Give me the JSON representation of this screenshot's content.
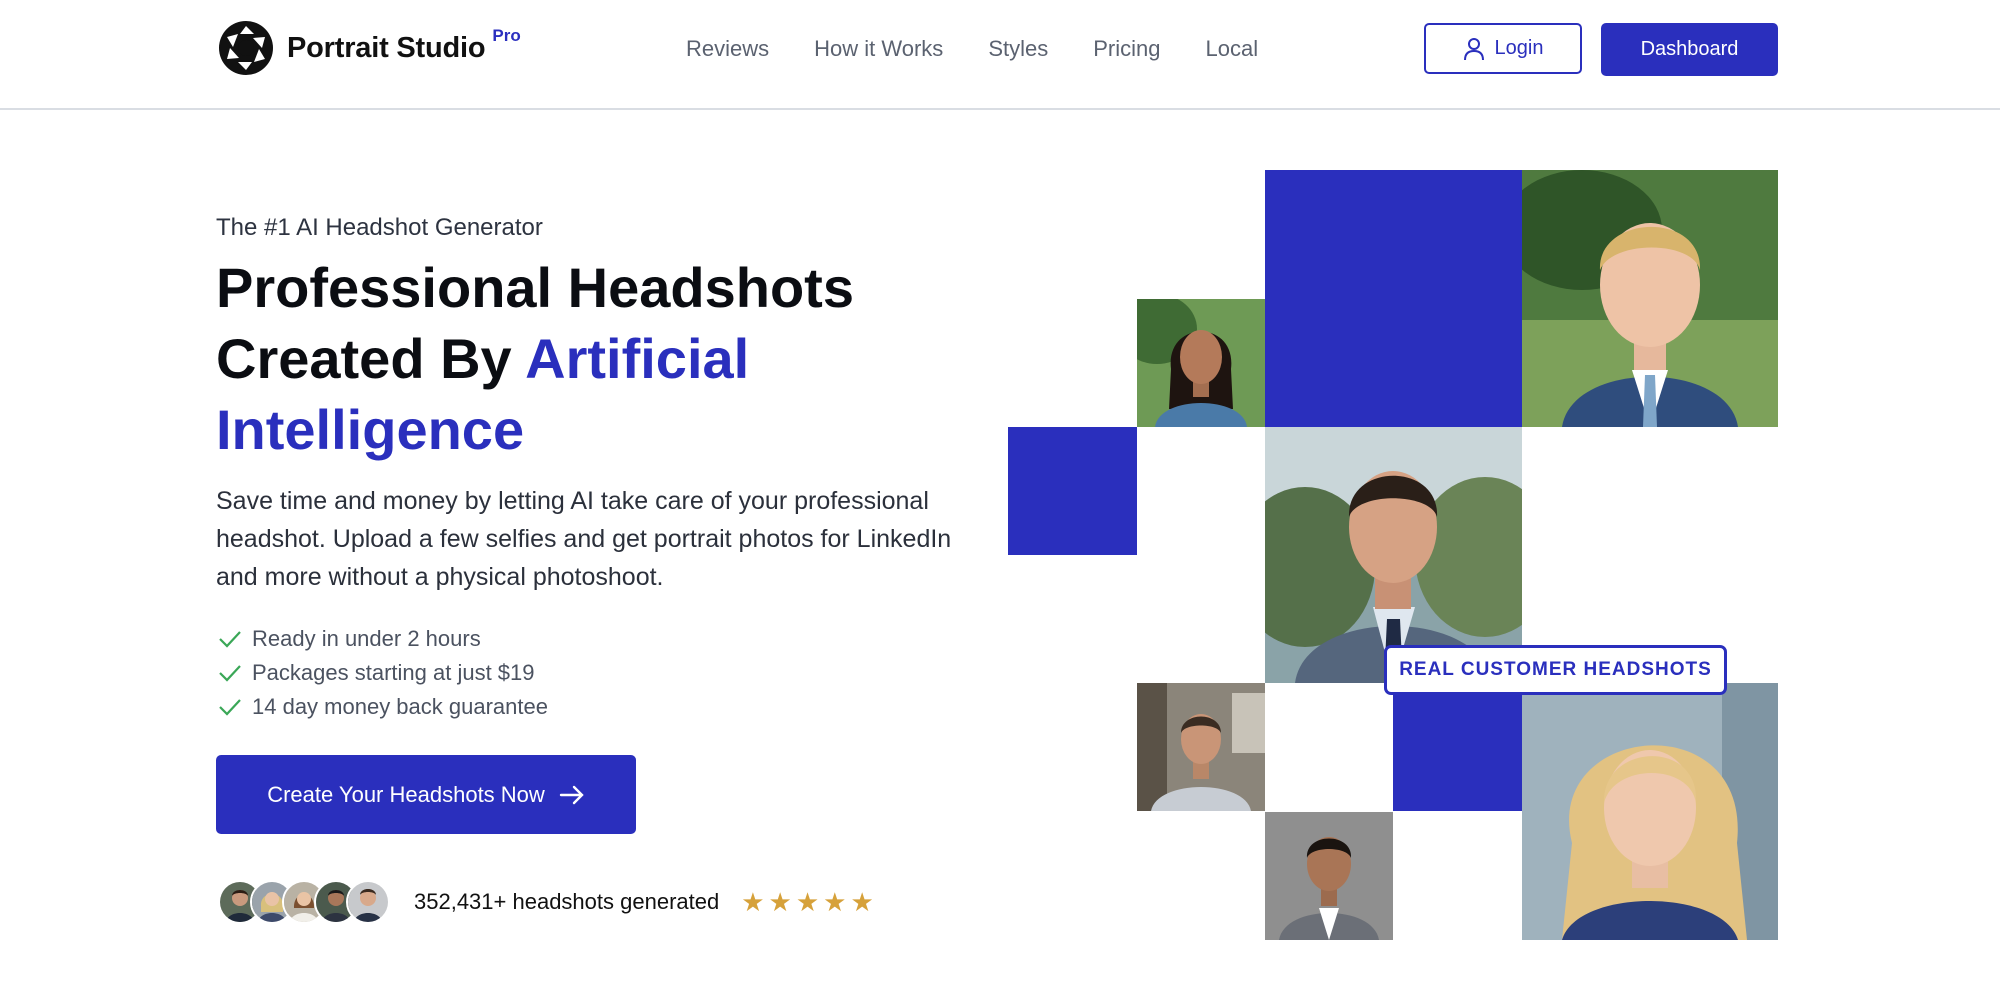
{
  "brand": {
    "name": "Portrait Studio",
    "tier": "Pro",
    "logo_icon": "aperture-icon"
  },
  "nav": [
    {
      "label": "Reviews"
    },
    {
      "label": "How it Works"
    },
    {
      "label": "Styles"
    },
    {
      "label": "Pricing"
    },
    {
      "label": "Local"
    }
  ],
  "header": {
    "login_label": "Login",
    "login_icon": "user-icon",
    "dashboard_label": "Dashboard"
  },
  "hero": {
    "eyebrow": "The #1 AI Headshot Generator",
    "headline_line1": "Professional Headshots",
    "headline_line2_plain": "Created By ",
    "headline_line2_accent": "Artificial",
    "headline_line3_accent": "Intelligence",
    "lead": "Save time and money by letting AI take care of your professional headshot. Upload a few selfies and get portrait photos for LinkedIn and more without a physical photoshoot.",
    "checks": [
      {
        "text": "Ready in under 2 hours"
      },
      {
        "text": "Packages starting at just $19"
      },
      {
        "text": "14 day money back guarantee"
      }
    ],
    "cta_label": "Create Your Headshots Now",
    "cta_icon": "arrow-right-icon",
    "proof_text": "352,431+ headshots generated",
    "rating": 5,
    "badge": "REAL CUSTOMER HEADSHOTS"
  },
  "colors": {
    "accent": "#2a2fbd",
    "star": "#d6a13a",
    "check": "#3aa757"
  }
}
